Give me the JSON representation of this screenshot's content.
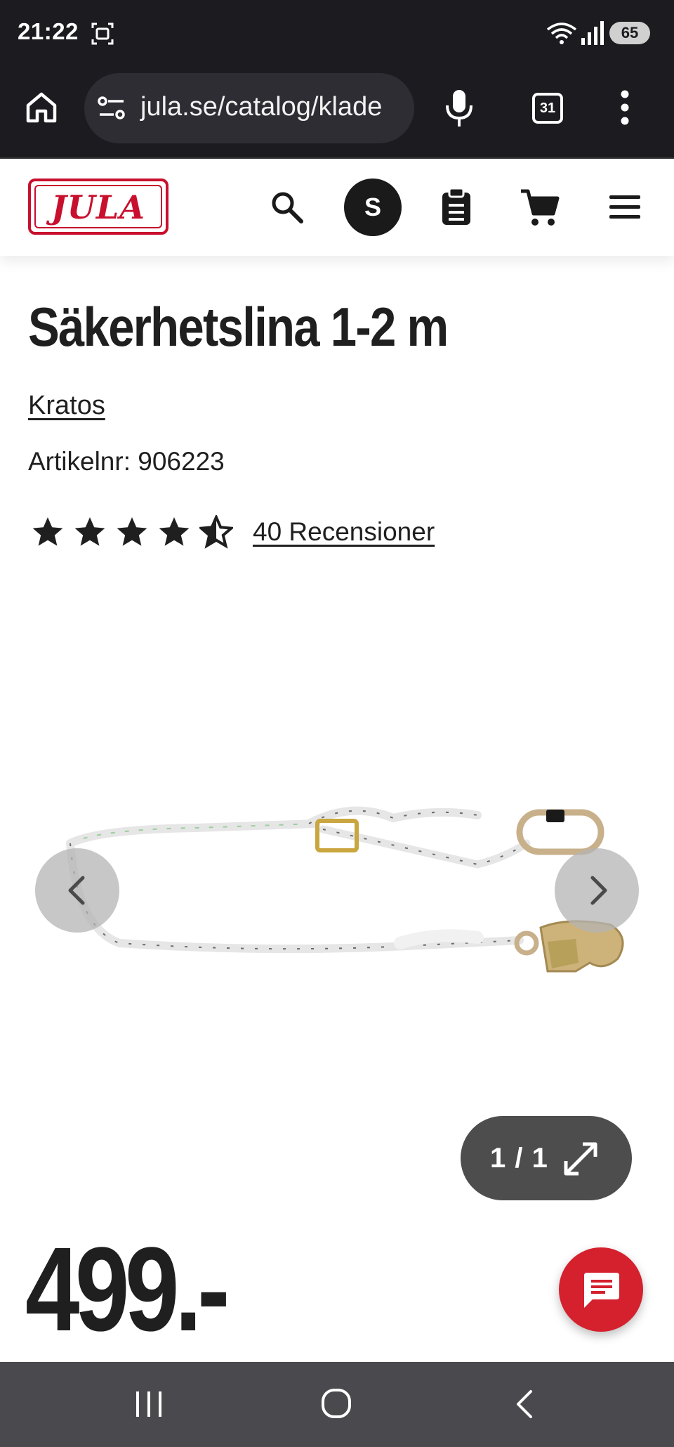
{
  "status_bar": {
    "time": "21:22",
    "battery": "65",
    "icons": [
      "screenshot-icon",
      "wifi-icon",
      "signal-icon",
      "battery-icon"
    ]
  },
  "browser": {
    "url": "jula.se/catalog/klade",
    "tab_count": "31",
    "icons": [
      "home-icon",
      "site-settings-icon",
      "mic-icon",
      "tabs-icon",
      "more-icon"
    ]
  },
  "site_header": {
    "logo_text": "JULA",
    "avatar_initial": "S",
    "icons": [
      "search-icon",
      "clipboard-icon",
      "cart-icon",
      "menu-icon"
    ]
  },
  "product": {
    "title": "Säkerhetslina 1-2 m",
    "brand": "Kratos",
    "article_number": "Artikelnr: 906223",
    "rating": 4.5,
    "rating_max": 5,
    "reviews_label": "40 Recensioner",
    "price": "499.-"
  },
  "gallery": {
    "counter": "1 / 1",
    "image_alt": "product-image"
  },
  "colors": {
    "brand_red": "#c8102e",
    "chat_red": "#d5202e",
    "dark": "#1c1b1f"
  }
}
